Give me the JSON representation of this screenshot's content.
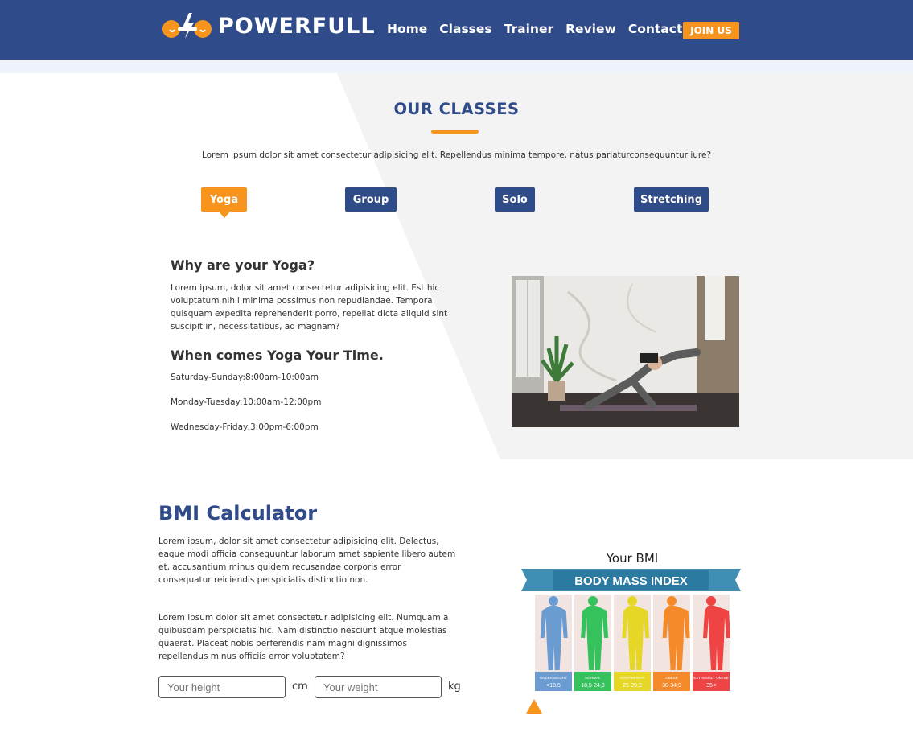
{
  "brand": {
    "name": "POWERFULL"
  },
  "nav": {
    "links": [
      "Home",
      "Classes",
      "Trainer",
      "Review",
      "Contact"
    ],
    "join_label": "JOIN US"
  },
  "classes": {
    "title": "OUR CLASSES",
    "intro": "Lorem ipsum dolor sit amet consectetur adipisicing elit. Repellendus minima tempore, natus pariaturconsequuntur iure?",
    "tabs": [
      "Yoga",
      "Group",
      "Solo",
      "Stretching"
    ],
    "active_tab": "Yoga",
    "why_title": "Why are your Yoga?",
    "why_text": "Lorem ipsum, dolor sit amet consectetur adipisicing elit. Est hic voluptatum nihil minima possimus non repudiandae. Tempora quisquam expedita reprehenderit porro, repellat dicta aliquid sint suscipit in, necessitatibus, ad magnam?",
    "when_title": "When comes Yoga Your Time.",
    "schedule": [
      "Saturday-Sunday:8:00am-10:00am",
      "Monday-Tuesday:10:00am-12:00pm",
      "Wednesday-Friday:3:00pm-6:00pm"
    ]
  },
  "bmi": {
    "title": "BMI Calculator",
    "para1": "Lorem ipsum, dolor sit amet consectetur adipisicing elit. Delectus, eaque modi officia consequuntur laborum amet sapiente libero autem et, accusantium minus quidem recusandae corporis error consequatur reiciendis perspiciatis distinctio non.",
    "para2": "Lorem ipsum dolor sit amet consectetur adipisicing elit. Numquam a quibusdam perspiciatis hic. Nam distinctio nesciunt atque molestias quaerat. Placeat nobis perferendis nam magni dignissimos repellendus minus officiis error voluptatem?",
    "height_placeholder": "Your height",
    "height_unit": "cm",
    "weight_placeholder": "Your weight",
    "weight_unit": "kg",
    "result_label": "Your BMI",
    "chart": {
      "banner": "BODY MASS INDEX",
      "categories": [
        {
          "name": "UNDERWEIGHT",
          "range": "<18,5",
          "color": "#6a9bd1"
        },
        {
          "name": "NORMAL",
          "range": "18,5-24,9",
          "color": "#35c15b"
        },
        {
          "name": "OVERWEIGHT",
          "range": "25-29,9",
          "color": "#e6d727"
        },
        {
          "name": "OBESE",
          "range": "30-34,9",
          "color": "#f58a2a"
        },
        {
          "name": "EXTREMELY OBESE",
          "range": "35<",
          "color": "#ef4444"
        }
      ]
    }
  },
  "colors": {
    "primary": "#2f4b8a",
    "accent": "#f7941d",
    "panel": "#f3f3f3"
  }
}
